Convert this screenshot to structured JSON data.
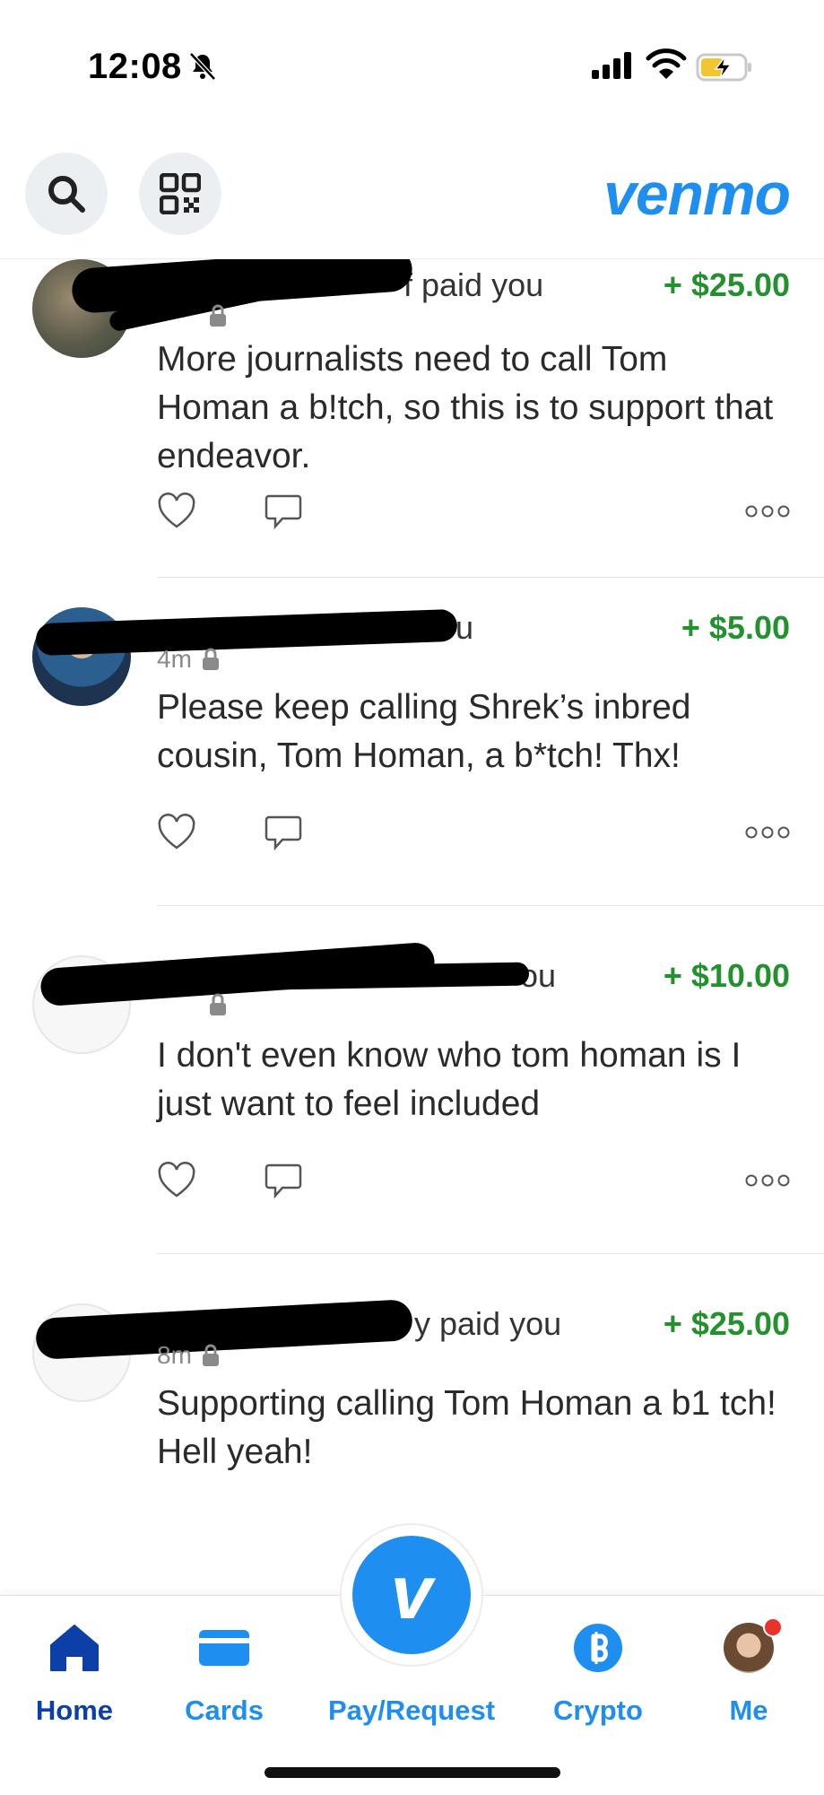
{
  "status_bar": {
    "time": "12:08"
  },
  "header": {
    "logo": "venmo",
    "search_icon": "search-icon",
    "qr_icon": "qr-code-icon"
  },
  "feed": [
    {
      "actor_suffix": "f paid you",
      "amount": "+ $25.00",
      "time": "",
      "note": "More journalists need to call Tom Homan a b!tch, so this is to support that endeavor."
    },
    {
      "actor_suffix": "u",
      "amount": "+ $5.00",
      "time": "4m",
      "note": "Please keep calling Shrek’s inbred cousin, Tom Homan, a b*tch! Thx!"
    },
    {
      "actor_suffix": "ou",
      "amount": "+ $10.00",
      "time": "",
      "note": "I don't even know who tom homan is I just want to feel included"
    },
    {
      "actor_suffix": "y paid you",
      "amount": "+ $25.00",
      "time": "8m",
      "note": "Supporting calling Tom Homan a b1 tch! Hell yeah!"
    }
  ],
  "tabbar": {
    "home": "Home",
    "cards": "Cards",
    "pay_request": "Pay/Request",
    "crypto": "Crypto",
    "me": "Me",
    "fab_glyph": "v"
  },
  "colors": {
    "brand_blue": "#1f8ef1",
    "active_tab": "#0c3fa7",
    "amount_green": "#23912d"
  }
}
